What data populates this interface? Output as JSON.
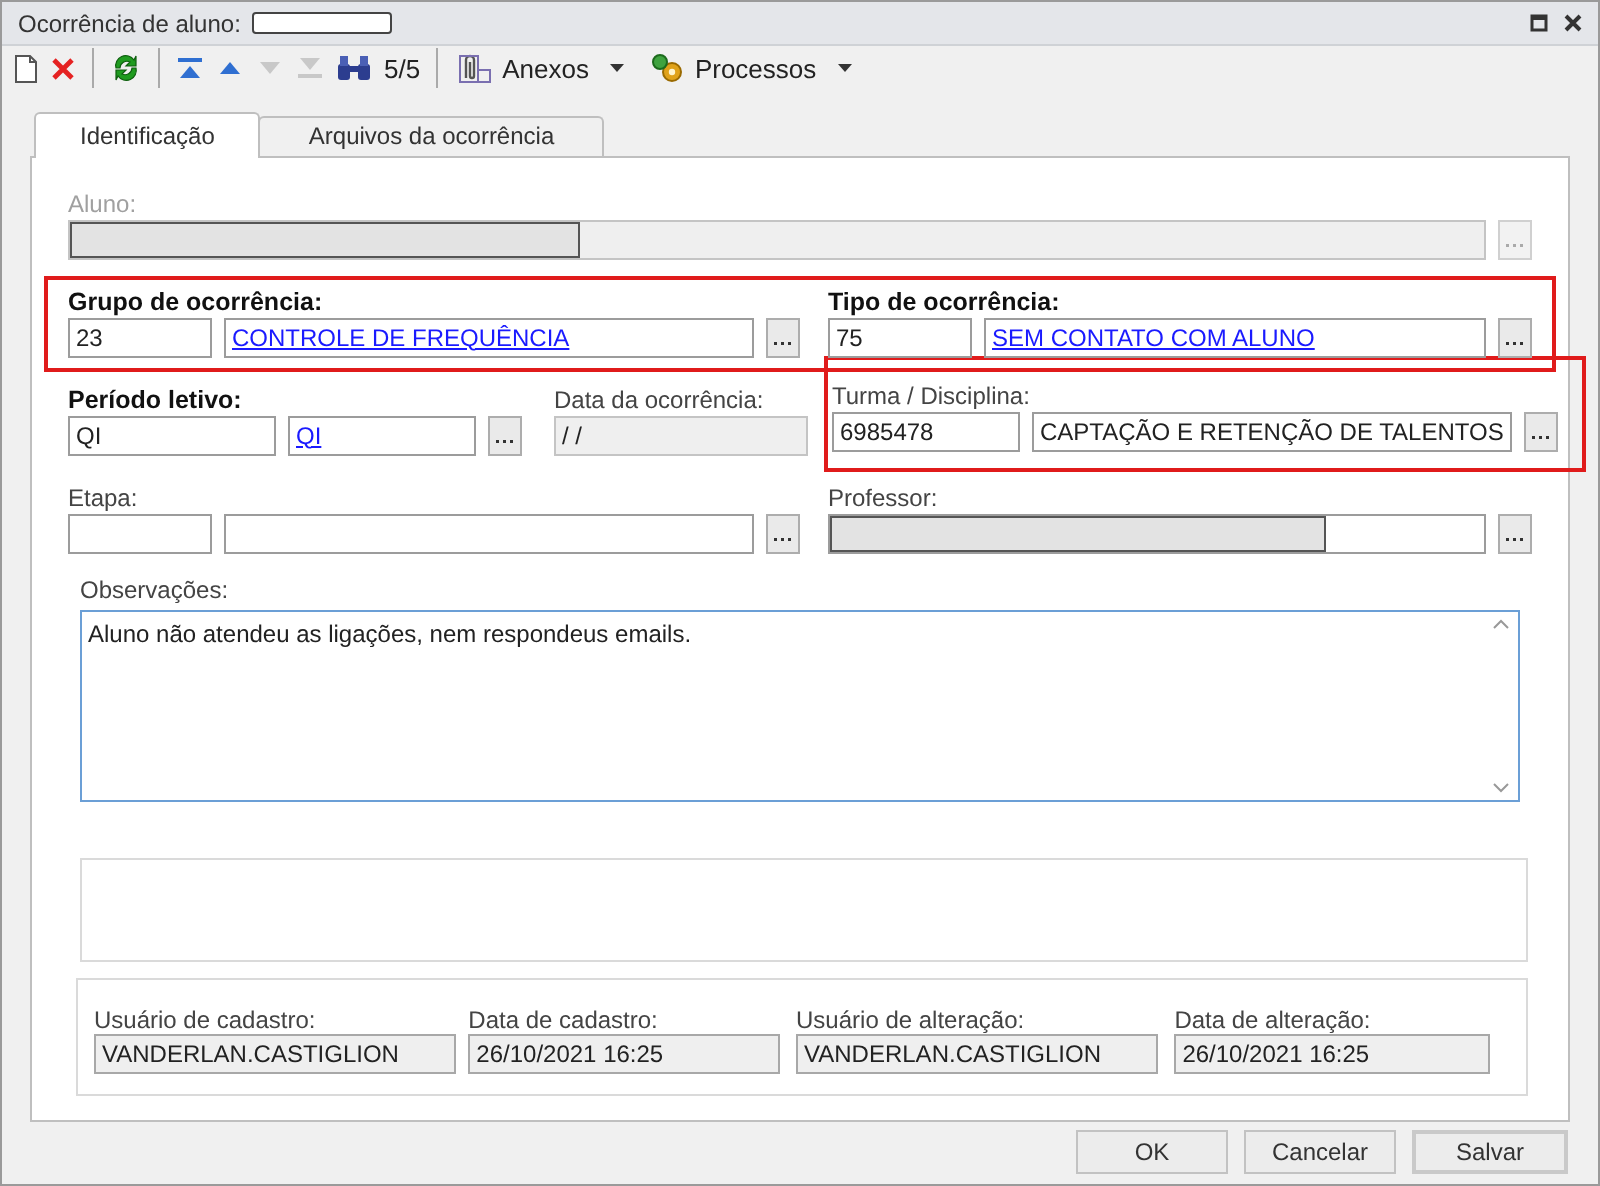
{
  "window": {
    "title": "Ocorrência de aluno:",
    "redacted": true
  },
  "toolbar": {
    "buttons": [
      {
        "kind": "new",
        "disabled": false
      },
      {
        "kind": "delete",
        "disabled": false
      },
      {
        "kind": "refresh",
        "disabled": false
      },
      {
        "kind": "first",
        "disabled": false
      },
      {
        "kind": "prev",
        "disabled": false
      },
      {
        "kind": "next",
        "disabled": true
      },
      {
        "kind": "last",
        "disabled": true
      },
      {
        "kind": "find",
        "disabled": false
      }
    ],
    "counter": "5/5",
    "menus": [
      {
        "kind": "attach",
        "label": "Anexos"
      },
      {
        "kind": "process",
        "label": "Processos"
      }
    ]
  },
  "tabs": [
    {
      "label": "Identificação",
      "selected": true
    },
    {
      "label": "Arquivos da ocorrência",
      "selected": false
    }
  ],
  "rows": [
    {
      "highlighted": false,
      "fields": [
        {
          "kind": "single",
          "label": "Aluno:",
          "disabled": true,
          "redacted": true
        }
      ]
    },
    {
      "highlighted": true,
      "fields": [
        {
          "kind": "lookup",
          "label": "Grupo de ocorrência:",
          "required": true,
          "code": "23",
          "description": "CONTROLE DE FREQUÊNCIA",
          "link": true
        },
        {
          "kind": "lookup",
          "label": "Tipo de ocorrência:",
          "required": true,
          "code": "75",
          "description": "SEM CONTATO COM ALUNO",
          "link": true
        }
      ]
    },
    {
      "highlighted": false,
      "fields": [
        {
          "kind": "lookup",
          "label": "Período letivo:",
          "required": true,
          "code": "QI",
          "description": "QI",
          "link": true
        },
        {
          "kind": "date",
          "label": "Data da ocorrência:",
          "value": " / /",
          "disabled": true
        },
        {
          "kind": "lookup",
          "label": "Turma / Disciplina:",
          "required": false,
          "code": "6985478",
          "description": "CAPTAÇÃO E RETENÇÃO DE TALENTOS",
          "link": false,
          "highlighted": true
        }
      ]
    },
    {
      "highlighted": false,
      "fields": [
        {
          "kind": "lookup",
          "label": "Etapa:",
          "required": false
        },
        {
          "kind": "single",
          "label": "Professor:",
          "disabled": false,
          "redacted": true
        }
      ]
    }
  ],
  "notes": {
    "label": "Observações:",
    "value": "Aluno não atendeu as ligações, nem respondeus emails.",
    "focused": true
  },
  "audit": [
    {
      "label": "Usuário de cadastro:",
      "value": "VANDERLAN.CASTIGLION"
    },
    {
      "label": "Data de cadastro:",
      "value": "26/10/2021 16:25"
    },
    {
      "label": "Usuário de alteração:",
      "value": "VANDERLAN.CASTIGLION"
    },
    {
      "label": "Data de alteração:",
      "value": "26/10/2021 16:25"
    }
  ],
  "buttons": [
    {
      "label": "OK",
      "default": false
    },
    {
      "label": "Cancelar",
      "default": false
    },
    {
      "label": "Salvar",
      "default": true
    }
  ]
}
